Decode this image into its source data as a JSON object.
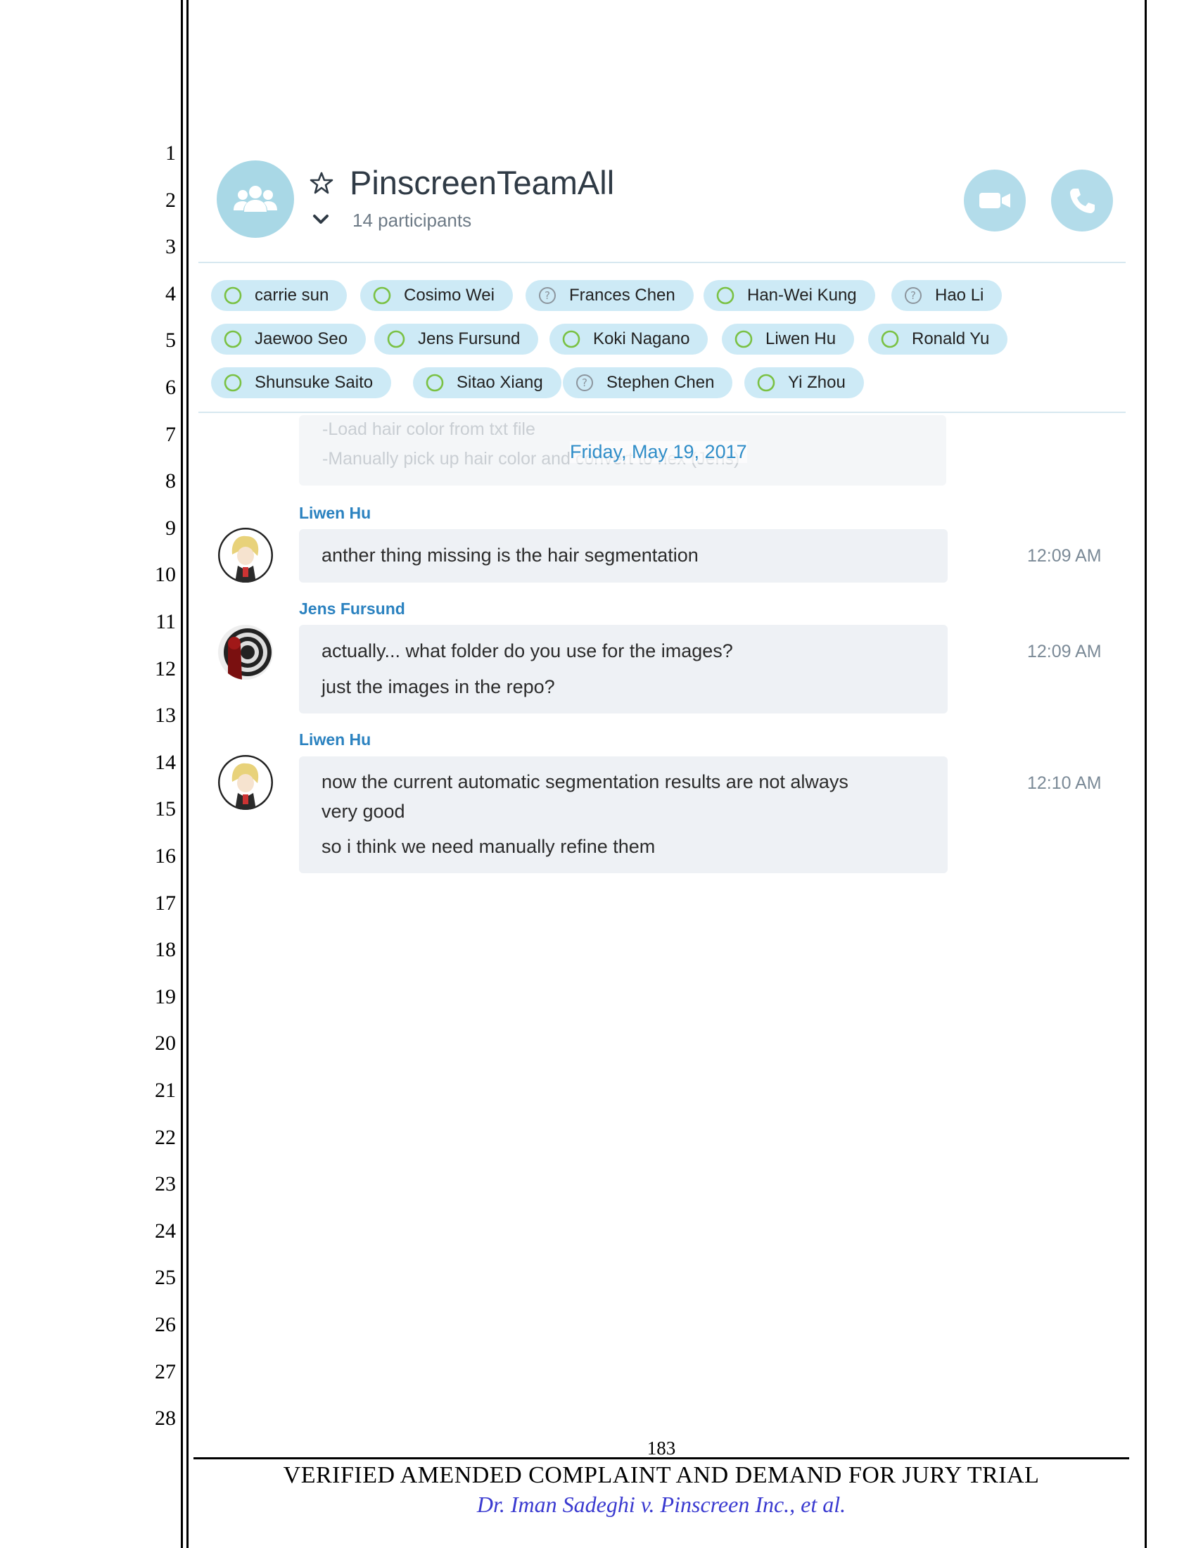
{
  "line_numbers": [
    "1",
    "2",
    "3",
    "4",
    "5",
    "6",
    "7",
    "8",
    "9",
    "10",
    "11",
    "12",
    "13",
    "14",
    "15",
    "16",
    "17",
    "18",
    "19",
    "20",
    "21",
    "22",
    "23",
    "24",
    "25",
    "26",
    "27",
    "28"
  ],
  "header": {
    "group_name": "PinscreenTeamAll",
    "participant_count": "14 participants",
    "group_icon": "people-icon",
    "video_icon": "video-camera-icon",
    "call_icon": "phone-icon"
  },
  "participants": [
    {
      "name": "carrie sun",
      "status": "available"
    },
    {
      "name": "Cosimo Wei",
      "status": "available"
    },
    {
      "name": "Frances Chen",
      "status": "unknown"
    },
    {
      "name": "Han-Wei Kung",
      "status": "available"
    },
    {
      "name": "Hao Li",
      "status": "unknown"
    },
    {
      "name": "Jaewoo Seo",
      "status": "available"
    },
    {
      "name": "Jens Fursund",
      "status": "available"
    },
    {
      "name": "Koki Nagano",
      "status": "available"
    },
    {
      "name": "Liwen Hu",
      "status": "available"
    },
    {
      "name": "Ronald Yu",
      "status": "available"
    },
    {
      "name": "Shunsuke Saito",
      "status": "available"
    },
    {
      "name": "Sitao Xiang",
      "status": "available"
    },
    {
      "name": "Stephen Chen",
      "status": "unknown"
    },
    {
      "name": "Yi Zhou",
      "status": "available"
    }
  ],
  "chat": {
    "faded_lines": [
      "-Load hair color from txt file",
      "-Manually pick up hair color and convert to hex (Jens)"
    ],
    "date_divider": "Friday, May 19, 2017",
    "messages": [
      {
        "sender": "Liwen Hu",
        "lines": [
          "anther thing missing is the hair segmentation"
        ],
        "time": "12:09 AM"
      },
      {
        "sender": "Jens Fursund",
        "lines": [
          "actually... what folder do you use for the images?",
          "just the images in the repo?"
        ],
        "time": "12:09 AM"
      },
      {
        "sender": "Liwen Hu",
        "lines": [
          "now the current automatic segmentation results are not always",
          "very good",
          "so i think we need manually refine them"
        ],
        "time": "12:10 AM"
      }
    ]
  },
  "footer": {
    "page_number": "183",
    "title": "VERIFIED AMENDED COMPLAINT AND DEMAND FOR JURY TRIAL",
    "case": "Dr. Iman Sadeghi v. Pinscreen Inc., et al."
  },
  "colors": {
    "accent": "#2b82c0",
    "chip_bg": "#cdeaf6",
    "available": "#7ac143",
    "unknown": "#8c959d",
    "case_text": "#3a3ad0"
  }
}
